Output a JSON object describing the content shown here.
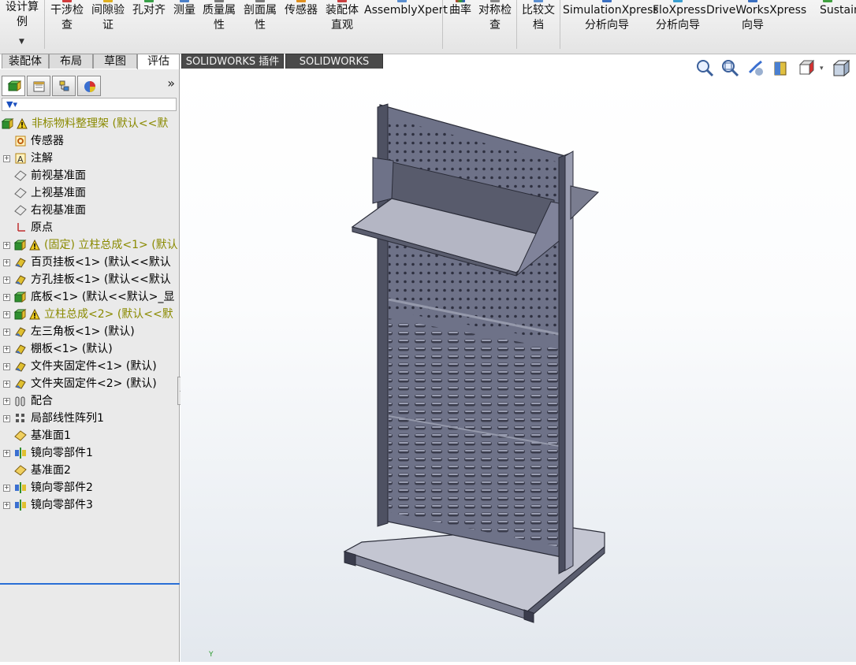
{
  "ribbon": {
    "items": [
      {
        "label": "设计算例"
      },
      {
        "label": "干涉检查"
      },
      {
        "label": "间隙验证"
      },
      {
        "label": "孔对齐"
      },
      {
        "label": "测量"
      },
      {
        "label": "质量属性"
      },
      {
        "label": "剖面属性"
      },
      {
        "label": "传感器"
      },
      {
        "label": "装配体直观"
      },
      {
        "label": "AssemblyXpert"
      },
      {
        "label": "曲率"
      },
      {
        "label": "对称检查"
      },
      {
        "label": "比较文档"
      },
      {
        "label": "SimulationXpress 分析向导"
      },
      {
        "label": "FloXpress 分析向导"
      },
      {
        "label": "DriveWorksXpress 向导"
      },
      {
        "label": "Sustain"
      }
    ]
  },
  "tabs": [
    {
      "label": "装配体"
    },
    {
      "label": "布局"
    },
    {
      "label": "草图"
    },
    {
      "label": "评估"
    },
    {
      "label": "SOLIDWORKS 插件"
    },
    {
      "label": "SOLIDWORKS MBD"
    }
  ],
  "panel": {
    "expand_label": "»",
    "tree": [
      {
        "text": "非标物料整理架  (默认<<默",
        "icon": "assembly-icon",
        "warn": true,
        "olive": true,
        "exp": false,
        "lead": true
      },
      {
        "text": "传感器",
        "icon": "sensor-icon"
      },
      {
        "text": "注解",
        "icon": "annotation-icon",
        "exp": true
      },
      {
        "text": "前视基准面",
        "icon": "plane-icon"
      },
      {
        "text": "上视基准面",
        "icon": "plane-icon"
      },
      {
        "text": "右视基准面",
        "icon": "plane-icon"
      },
      {
        "text": "原点",
        "icon": "origin-icon"
      },
      {
        "text": "(固定) 立柱总成<1> (默认",
        "icon": "assembly-icon",
        "warn": true,
        "olive": true,
        "exp": true
      },
      {
        "text": "百页挂板<1> (默认<<默认",
        "icon": "part-icon",
        "exp": true
      },
      {
        "text": "方孔挂板<1> (默认<<默认",
        "icon": "part-icon",
        "exp": true
      },
      {
        "text": "底板<1> (默认<<默认>_显",
        "icon": "assembly-icon",
        "exp": true
      },
      {
        "text": "立柱总成<2> (默认<<默",
        "icon": "assembly-icon",
        "warn": true,
        "olive": true,
        "exp": true
      },
      {
        "text": "左三角板<1> (默认)",
        "icon": "part-icon",
        "exp": true
      },
      {
        "text": "棚板<1> (默认)",
        "icon": "part-icon",
        "exp": true
      },
      {
        "text": "文件夹固定件<1> (默认)",
        "icon": "part-icon",
        "exp": true
      },
      {
        "text": "文件夹固定件<2> (默认)",
        "icon": "part-icon",
        "exp": true
      },
      {
        "text": "配合",
        "icon": "mate-icon",
        "exp": true
      },
      {
        "text": "局部线性阵列1",
        "icon": "pattern-icon",
        "exp": true
      },
      {
        "text": "基准面1",
        "icon": "ref-plane-icon"
      },
      {
        "text": "镜向零部件1",
        "icon": "mirror-icon",
        "exp": true
      },
      {
        "text": "基准面2",
        "icon": "ref-plane-icon"
      },
      {
        "text": "镜向零部件2",
        "icon": "mirror-icon",
        "exp": true
      },
      {
        "text": "镜向零部件3",
        "icon": "mirror-icon",
        "exp": true
      }
    ]
  },
  "view": {
    "axis_label": "Y",
    "model_color": "#6e7288"
  }
}
